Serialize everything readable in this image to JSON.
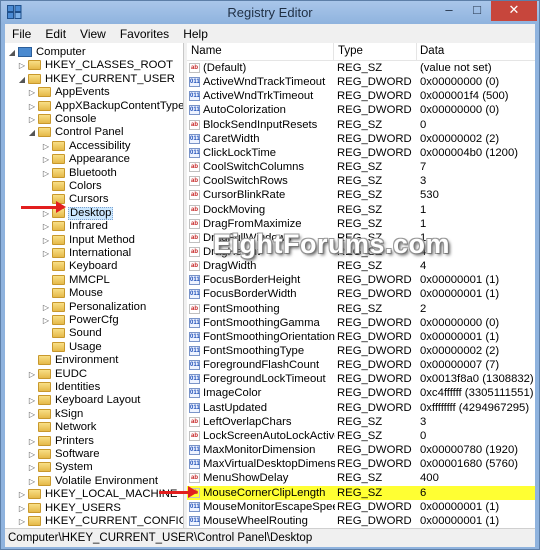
{
  "window": {
    "title": "Registry Editor"
  },
  "menu": [
    "File",
    "Edit",
    "View",
    "Favorites",
    "Help"
  ],
  "tree": [
    {
      "label": "Computer",
      "icon": "computer",
      "exp": "◢",
      "x": 6
    },
    {
      "label": "HKEY_CLASSES_ROOT",
      "exp": "▷",
      "x": 16
    },
    {
      "label": "HKEY_CURRENT_USER",
      "exp": "◢",
      "x": 16
    },
    {
      "label": "AppEvents",
      "exp": "▷",
      "x": 26
    },
    {
      "label": "AppXBackupContentType",
      "exp": "▷",
      "x": 26
    },
    {
      "label": "Console",
      "exp": "▷",
      "x": 26
    },
    {
      "label": "Control Panel",
      "exp": "◢",
      "x": 26
    },
    {
      "label": "Accessibility",
      "exp": "▷",
      "x": 40
    },
    {
      "label": "Appearance",
      "exp": "▷",
      "x": 40
    },
    {
      "label": "Bluetooth",
      "exp": "▷",
      "x": 40
    },
    {
      "label": "Colors",
      "exp": "",
      "x": 40
    },
    {
      "label": "Cursors",
      "exp": "",
      "x": 40
    },
    {
      "label": "Desktop",
      "exp": "▷",
      "x": 40,
      "selected": true
    },
    {
      "label": "Infrared",
      "exp": "▷",
      "x": 40
    },
    {
      "label": "Input Method",
      "exp": "▷",
      "x": 40
    },
    {
      "label": "International",
      "exp": "▷",
      "x": 40
    },
    {
      "label": "Keyboard",
      "exp": "",
      "x": 40
    },
    {
      "label": "MMCPL",
      "exp": "",
      "x": 40
    },
    {
      "label": "Mouse",
      "exp": "",
      "x": 40
    },
    {
      "label": "Personalization",
      "exp": "▷",
      "x": 40
    },
    {
      "label": "PowerCfg",
      "exp": "▷",
      "x": 40
    },
    {
      "label": "Sound",
      "exp": "",
      "x": 40
    },
    {
      "label": "Usage",
      "exp": "",
      "x": 40
    },
    {
      "label": "Environment",
      "exp": "",
      "x": 26
    },
    {
      "label": "EUDC",
      "exp": "▷",
      "x": 26
    },
    {
      "label": "Identities",
      "exp": "",
      "x": 26
    },
    {
      "label": "Keyboard Layout",
      "exp": "▷",
      "x": 26
    },
    {
      "label": "kSign",
      "exp": "▷",
      "x": 26
    },
    {
      "label": "Network",
      "exp": "",
      "x": 26
    },
    {
      "label": "Printers",
      "exp": "▷",
      "x": 26
    },
    {
      "label": "Software",
      "exp": "▷",
      "x": 26
    },
    {
      "label": "System",
      "exp": "▷",
      "x": 26
    },
    {
      "label": "Volatile Environment",
      "exp": "▷",
      "x": 26
    },
    {
      "label": "HKEY_LOCAL_MACHINE",
      "exp": "▷",
      "x": 16
    },
    {
      "label": "HKEY_USERS",
      "exp": "▷",
      "x": 16
    },
    {
      "label": "HKEY_CURRENT_CONFIG",
      "exp": "▷",
      "x": 16
    }
  ],
  "columns": {
    "name": "Name",
    "type": "Type",
    "data": "Data"
  },
  "values": [
    {
      "name": "(Default)",
      "type": "REG_SZ",
      "data": "(value not set)"
    },
    {
      "name": "ActiveWndTrackTimeout",
      "type": "REG_DWORD",
      "data": "0x00000000 (0)"
    },
    {
      "name": "ActiveWndTrkTimeout",
      "type": "REG_DWORD",
      "data": "0x000001f4 (500)"
    },
    {
      "name": "AutoColorization",
      "type": "REG_DWORD",
      "data": "0x00000000 (0)"
    },
    {
      "name": "BlockSendInputResets",
      "type": "REG_SZ",
      "data": "0"
    },
    {
      "name": "CaretWidth",
      "type": "REG_DWORD",
      "data": "0x00000002 (2)"
    },
    {
      "name": "ClickLockTime",
      "type": "REG_DWORD",
      "data": "0x000004b0 (1200)"
    },
    {
      "name": "CoolSwitchColumns",
      "type": "REG_SZ",
      "data": "7"
    },
    {
      "name": "CoolSwitchRows",
      "type": "REG_SZ",
      "data": "3"
    },
    {
      "name": "CursorBlinkRate",
      "type": "REG_SZ",
      "data": "530"
    },
    {
      "name": "DockMoving",
      "type": "REG_SZ",
      "data": "1"
    },
    {
      "name": "DragFromMaximize",
      "type": "REG_SZ",
      "data": "1"
    },
    {
      "name": "DragFullWindows",
      "type": "REG_SZ",
      "data": "1"
    },
    {
      "name": "DragHeight",
      "type": "REG_SZ",
      "data": "4"
    },
    {
      "name": "DragWidth",
      "type": "REG_SZ",
      "data": "4"
    },
    {
      "name": "FocusBorderHeight",
      "type": "REG_DWORD",
      "data": "0x00000001 (1)"
    },
    {
      "name": "FocusBorderWidth",
      "type": "REG_DWORD",
      "data": "0x00000001 (1)"
    },
    {
      "name": "FontSmoothing",
      "type": "REG_SZ",
      "data": "2"
    },
    {
      "name": "FontSmoothingGamma",
      "type": "REG_DWORD",
      "data": "0x00000000 (0)"
    },
    {
      "name": "FontSmoothingOrientation",
      "type": "REG_DWORD",
      "data": "0x00000001 (1)"
    },
    {
      "name": "FontSmoothingType",
      "type": "REG_DWORD",
      "data": "0x00000002 (2)"
    },
    {
      "name": "ForegroundFlashCount",
      "type": "REG_DWORD",
      "data": "0x00000007 (7)"
    },
    {
      "name": "ForegroundLockTimeout",
      "type": "REG_DWORD",
      "data": "0x0013f8a0 (1308832)"
    },
    {
      "name": "ImageColor",
      "type": "REG_DWORD",
      "data": "0xc4ffffff (3305111551)"
    },
    {
      "name": "LastUpdated",
      "type": "REG_DWORD",
      "data": "0xffffffff (4294967295)"
    },
    {
      "name": "LeftOverlapChars",
      "type": "REG_SZ",
      "data": "3"
    },
    {
      "name": "LockScreenAutoLockActive",
      "type": "REG_SZ",
      "data": "0"
    },
    {
      "name": "MaxMonitorDimension",
      "type": "REG_DWORD",
      "data": "0x00000780 (1920)"
    },
    {
      "name": "MaxVirtualDesktopDimension",
      "type": "REG_DWORD",
      "data": "0x00001680 (5760)"
    },
    {
      "name": "MenuShowDelay",
      "type": "REG_SZ",
      "data": "400"
    },
    {
      "name": "MouseCornerClipLength",
      "type": "REG_SZ",
      "data": "6",
      "highlight": true
    },
    {
      "name": "MouseMonitorEscapeSpeed",
      "type": "REG_DWORD",
      "data": "0x00000001 (1)"
    },
    {
      "name": "MouseWheelRouting",
      "type": "REG_DWORD",
      "data": "0x00000001 (1)"
    }
  ],
  "statusbar": {
    "path": "Computer\\HKEY_CURRENT_USER\\Control Panel\\Desktop"
  },
  "watermark": "EightForums.com",
  "colors": {
    "highlight": "#ffff33",
    "arrow": "#e21e1e",
    "selection": "#cce8ff"
  }
}
